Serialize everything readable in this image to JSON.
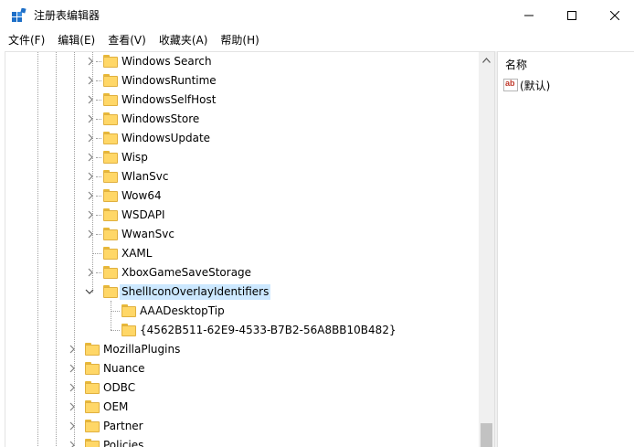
{
  "window": {
    "title": "注册表编辑器"
  },
  "menu": [
    {
      "label": "文件(F)"
    },
    {
      "label": "编辑(E)"
    },
    {
      "label": "查看(V)"
    },
    {
      "label": "收藏夹(A)"
    },
    {
      "label": "帮助(H)"
    }
  ],
  "tree": {
    "items": [
      {
        "label": "Windows Search"
      },
      {
        "label": "WindowsRuntime"
      },
      {
        "label": "WindowsSelfHost"
      },
      {
        "label": "WindowsStore"
      },
      {
        "label": "WindowsUpdate"
      },
      {
        "label": "Wisp"
      },
      {
        "label": "WlanSvc"
      },
      {
        "label": "Wow64"
      },
      {
        "label": "WSDAPI"
      },
      {
        "label": "WwanSvc"
      },
      {
        "label": "XAML"
      },
      {
        "label": "XboxGameSaveStorage"
      },
      {
        "label": "ShellIconOverlayIdentifiers"
      },
      {
        "label": "AAADesktopTip"
      },
      {
        "label": "{4562B511-62E9-4533-B7B2-56A8BB10B482}"
      },
      {
        "label": "MozillaPlugins"
      },
      {
        "label": "Nuance"
      },
      {
        "label": "ODBC"
      },
      {
        "label": "OEM"
      },
      {
        "label": "Partner"
      },
      {
        "label": "Policies"
      }
    ]
  },
  "values_pane": {
    "column_name": "名称",
    "rows": [
      {
        "icon": "string-value-icon",
        "name": "(默认)"
      }
    ]
  },
  "colors": {
    "selection": "#cce8ff",
    "folder": "#ffd767",
    "scroll_thumb": "#c2c2c2"
  }
}
